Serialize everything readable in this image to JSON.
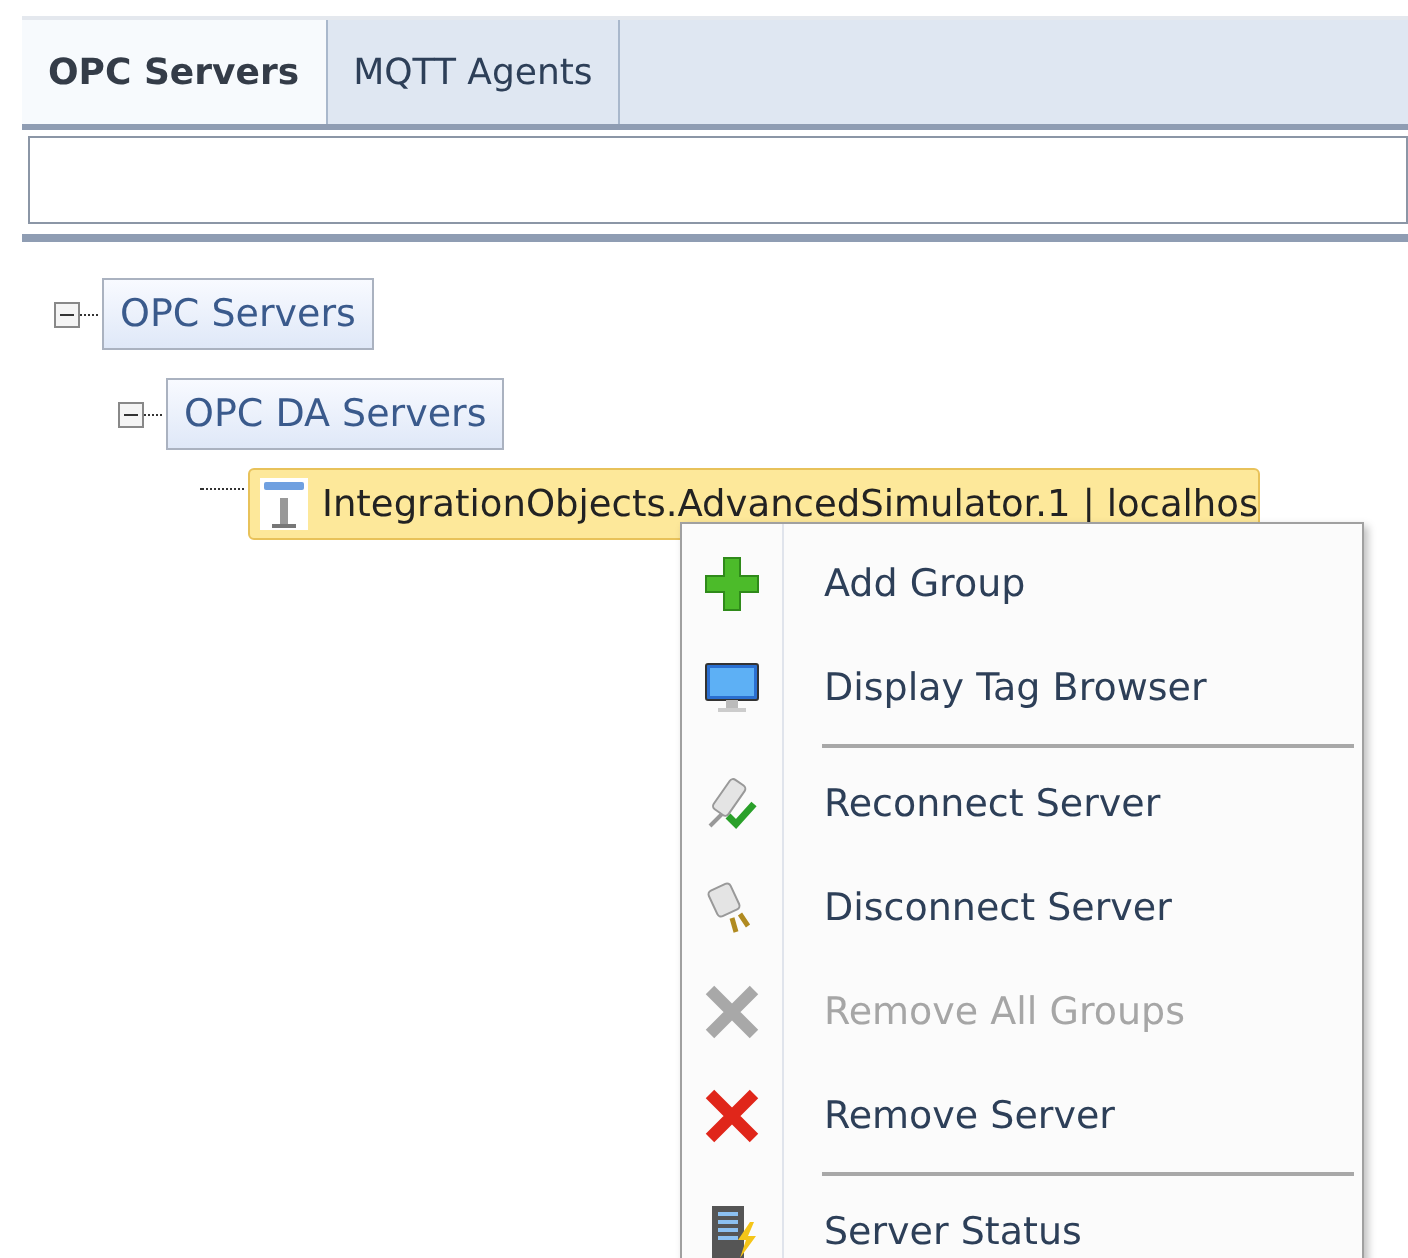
{
  "tabs": [
    {
      "label": "OPC Servers",
      "selected": true
    },
    {
      "label": "MQTT Agents",
      "selected": false
    }
  ],
  "tree": [
    {
      "label": "OPC Servers",
      "expanded": true,
      "children": [
        {
          "label": "OPC DA Servers",
          "expanded": true,
          "children": [
            {
              "label": "IntegrationObjects.AdvancedSimulator.1 | localhos",
              "selected": true,
              "kind": "server"
            }
          ]
        }
      ]
    }
  ],
  "context_menu": {
    "items": [
      {
        "kind": "item",
        "label": "Add Group",
        "disabled": false
      },
      {
        "kind": "item",
        "label": "Display Tag Browser",
        "disabled": false
      },
      {
        "kind": "separator"
      },
      {
        "kind": "item",
        "label": "Reconnect Server",
        "disabled": false
      },
      {
        "kind": "item",
        "label": "Disconnect Server",
        "disabled": false
      },
      {
        "kind": "item",
        "label": "Remove All Groups",
        "disabled": true
      },
      {
        "kind": "item",
        "label": "Remove Server",
        "disabled": false
      },
      {
        "kind": "separator"
      },
      {
        "kind": "item",
        "label": "Server Status",
        "disabled": false
      }
    ]
  }
}
